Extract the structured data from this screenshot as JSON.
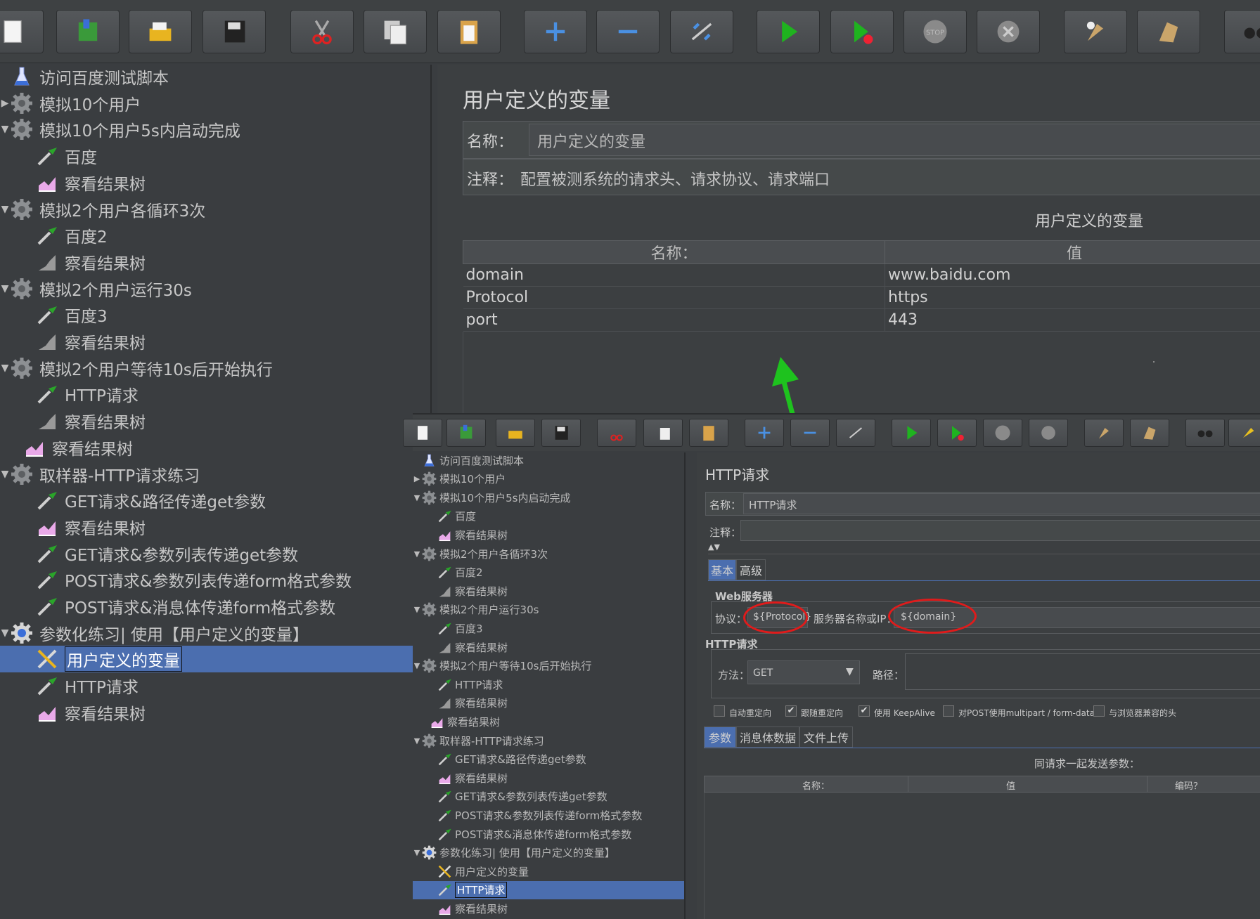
{
  "toolbar": {
    "buttons": [
      "new-icon",
      "templates-icon",
      "open-icon",
      "save-icon",
      "cut-icon",
      "copy-icon",
      "paste-icon",
      "expand-icon",
      "collapse-icon",
      "toggle-icon",
      "start-icon",
      "start-no-pauses-icon",
      "stop-icon",
      "shutdown-icon",
      "clear-icon",
      "clear-all-icon",
      "search-icon"
    ]
  },
  "tree": {
    "items": [
      {
        "label": "访问百度测试脚本"
      },
      {
        "label": "模拟10个用户"
      },
      {
        "label": "模拟10个用户5s内启动完成"
      },
      {
        "label": "百度"
      },
      {
        "label": "察看结果树"
      },
      {
        "label": "模拟2个用户各循环3次"
      },
      {
        "label": "百度2"
      },
      {
        "label": "察看结果树"
      },
      {
        "label": "模拟2个用户运行30s"
      },
      {
        "label": "百度3"
      },
      {
        "label": "察看结果树"
      },
      {
        "label": "模拟2个用户等待10s后开始执行"
      },
      {
        "label": "HTTP请求"
      },
      {
        "label": "察看结果树"
      },
      {
        "label": "察看结果树"
      },
      {
        "label": "取样器-HTTP请求练习"
      },
      {
        "label": "GET请求&路径传递get参数"
      },
      {
        "label": "察看结果树"
      },
      {
        "label": "GET请求&参数列表传递get参数"
      },
      {
        "label": "POST请求&参数列表传递form格式参数"
      },
      {
        "label": "POST请求&消息体传递form格式参数"
      },
      {
        "label": "参数化练习| 使用【用户定义的变量】"
      },
      {
        "label": "用户定义的变量"
      },
      {
        "label": "HTTP请求"
      },
      {
        "label": "察看结果树"
      }
    ]
  },
  "main": {
    "title": "用户定义的变量",
    "name_label": "名称：",
    "name_value": "用户定义的变量",
    "comment_label": "注释：",
    "comment_value": "配置被测系统的请求头、请求协议、请求端口",
    "table_title": "用户定义的变量",
    "col_name": "名称：",
    "col_value": "值",
    "rows": [
      {
        "name": "domain",
        "value": "www.baidu.com"
      },
      {
        "name": "Protocol",
        "value": "https"
      },
      {
        "name": "port",
        "value": "443"
      }
    ]
  },
  "inset": {
    "tree": {
      "items": [
        {
          "label": "访问百度测试脚本"
        },
        {
          "label": "模拟10个用户"
        },
        {
          "label": "模拟10个用户5s内启动完成"
        },
        {
          "label": "百度"
        },
        {
          "label": "察看结果树"
        },
        {
          "label": "模拟2个用户各循环3次"
        },
        {
          "label": "百度2"
        },
        {
          "label": "察看结果树"
        },
        {
          "label": "模拟2个用户运行30s"
        },
        {
          "label": "百度3"
        },
        {
          "label": "察看结果树"
        },
        {
          "label": "模拟2个用户等待10s后开始执行"
        },
        {
          "label": "HTTP请求"
        },
        {
          "label": "察看结果树"
        },
        {
          "label": "察看结果树"
        },
        {
          "label": "取样器-HTTP请求练习"
        },
        {
          "label": "GET请求&路径传递get参数"
        },
        {
          "label": "察看结果树"
        },
        {
          "label": "GET请求&参数列表传递get参数"
        },
        {
          "label": "POST请求&参数列表传递form格式参数"
        },
        {
          "label": "POST请求&消息体传递form格式参数"
        },
        {
          "label": "参数化练习| 使用【用户定义的变量】"
        },
        {
          "label": "用户定义的变量"
        },
        {
          "label": "HTTP请求"
        },
        {
          "label": "察看结果树"
        }
      ]
    },
    "panel": {
      "title": "HTTP请求",
      "name_label": "名称：",
      "name_value": "HTTP请求",
      "comment_label": "注释：",
      "tab_basic": "基本",
      "tab_advanced": "高级",
      "web_server": "Web服务器",
      "protocol_label": "协议：",
      "protocol_value": "${Protocol}",
      "server_label": "服务器名称或IP：",
      "server_value": "${domain}",
      "http_request": "HTTP请求",
      "method_label": "方法：",
      "method_value": "GET",
      "path_label": "路径：",
      "cb_redirect": "自动重定向",
      "cb_follow": "跟随重定向",
      "cb_keepalive": "使用 KeepAlive",
      "cb_multipart": "对POST使用multipart / form-data",
      "cb_browser": "与浏览器兼容的头",
      "tab_params": "参数",
      "tab_body": "消息体数据",
      "tab_files": "文件上传",
      "params_title": "同请求一起发送参数：",
      "col_name": "名称：",
      "col_value": "值",
      "col_encode": "编码？"
    }
  },
  "colors": {
    "selection": "#4b6eaf",
    "annotation_arrow": "#1ec21e",
    "annotation_ring": "#e01b1b"
  }
}
